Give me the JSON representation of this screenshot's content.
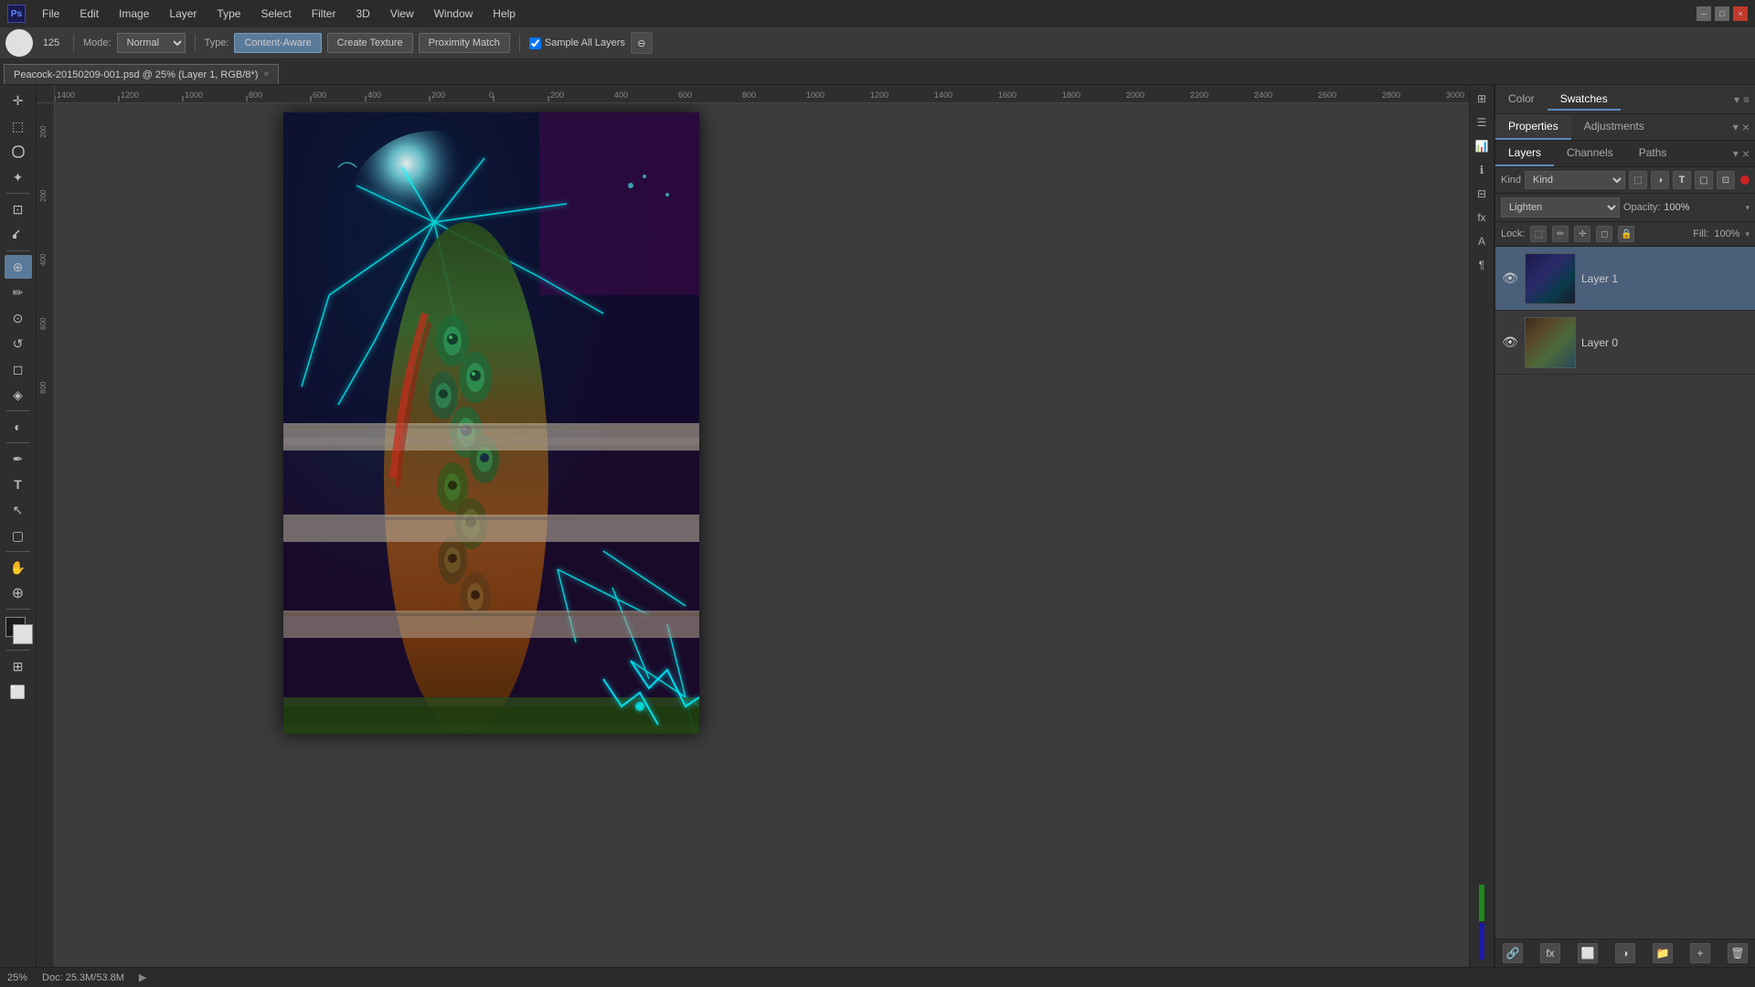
{
  "titlebar": {
    "logo": "Ps",
    "menus": [
      "File",
      "Edit",
      "Image",
      "Layer",
      "Type",
      "Select",
      "Filter",
      "3D",
      "View",
      "Window",
      "Help"
    ],
    "win_buttons": [
      "minimize",
      "maximize",
      "close"
    ]
  },
  "toolbar": {
    "brush_size": "125",
    "mode_label": "Mode:",
    "mode_value": "Normal",
    "type_label": "Type:",
    "type_value": "Content-Aware",
    "btn_create_texture": "Create Texture",
    "btn_proximity": "Proximity Match",
    "sample_checkbox_label": "Sample All Layers",
    "sample_checked": true
  },
  "tab": {
    "title": "Peacock-20150209-001.psd @ 25% (Layer 1, RGB/8*)",
    "close": "×"
  },
  "canvas": {
    "zoom": "25%",
    "doc_size": "Doc: 25.3M/53.8M",
    "ruler_unit": "px"
  },
  "right_panel": {
    "top_tabs": [
      "Color",
      "Swatches"
    ],
    "active_top_tab": "Swatches",
    "props_tabs": [
      "Properties",
      "Adjustments"
    ],
    "active_props_tab": "Properties",
    "layers_tabs": [
      "Layers",
      "Channels",
      "Paths"
    ],
    "active_layers_tab": "Layers",
    "kind_label": "Kind",
    "blend_mode": "Lighten",
    "opacity_label": "Opacity:",
    "opacity_value": "100%",
    "fill_label": "Fill:",
    "fill_value": "100%",
    "lock_label": "Lock:",
    "layers": [
      {
        "name": "Layer 1",
        "visible": true,
        "active": true,
        "thumb_class": "layer-thumb-1"
      },
      {
        "name": "Layer 0",
        "visible": true,
        "active": false,
        "thumb_class": "layer-thumb-0"
      }
    ]
  },
  "tools": {
    "left_tools": [
      {
        "id": "move",
        "icon": "✛",
        "active": false
      },
      {
        "id": "selection",
        "icon": "⬚",
        "active": false
      },
      {
        "id": "lasso",
        "icon": "⌖",
        "active": false
      },
      {
        "id": "magic-wand",
        "icon": "✦",
        "active": false
      },
      {
        "id": "crop",
        "icon": "⊡",
        "active": false
      },
      {
        "id": "eyedropper",
        "icon": "⊿",
        "active": false
      },
      {
        "id": "healing",
        "icon": "⊕",
        "active": true
      },
      {
        "id": "brush",
        "icon": "✏",
        "active": false
      },
      {
        "id": "clone",
        "icon": "⊙",
        "active": false
      },
      {
        "id": "eraser",
        "icon": "◻",
        "active": false
      },
      {
        "id": "fill",
        "icon": "◈",
        "active": false
      },
      {
        "id": "dodge",
        "icon": "◐",
        "active": false
      },
      {
        "id": "pen",
        "icon": "✒",
        "active": false
      },
      {
        "id": "text",
        "icon": "T",
        "active": false
      },
      {
        "id": "path-select",
        "icon": "↖",
        "active": false
      },
      {
        "id": "rect-shape",
        "icon": "▢",
        "active": false
      },
      {
        "id": "hand",
        "icon": "✋",
        "active": false
      },
      {
        "id": "zoom",
        "icon": "⊕",
        "active": false
      }
    ]
  },
  "colors": {
    "accent_blue": "#5a8abf",
    "bg_dark": "#2b2b2b",
    "panel_bg": "#3a3a3a",
    "layer1_indicator": "#1a8a1a",
    "layer0_indicator": "#1a1aaa"
  }
}
